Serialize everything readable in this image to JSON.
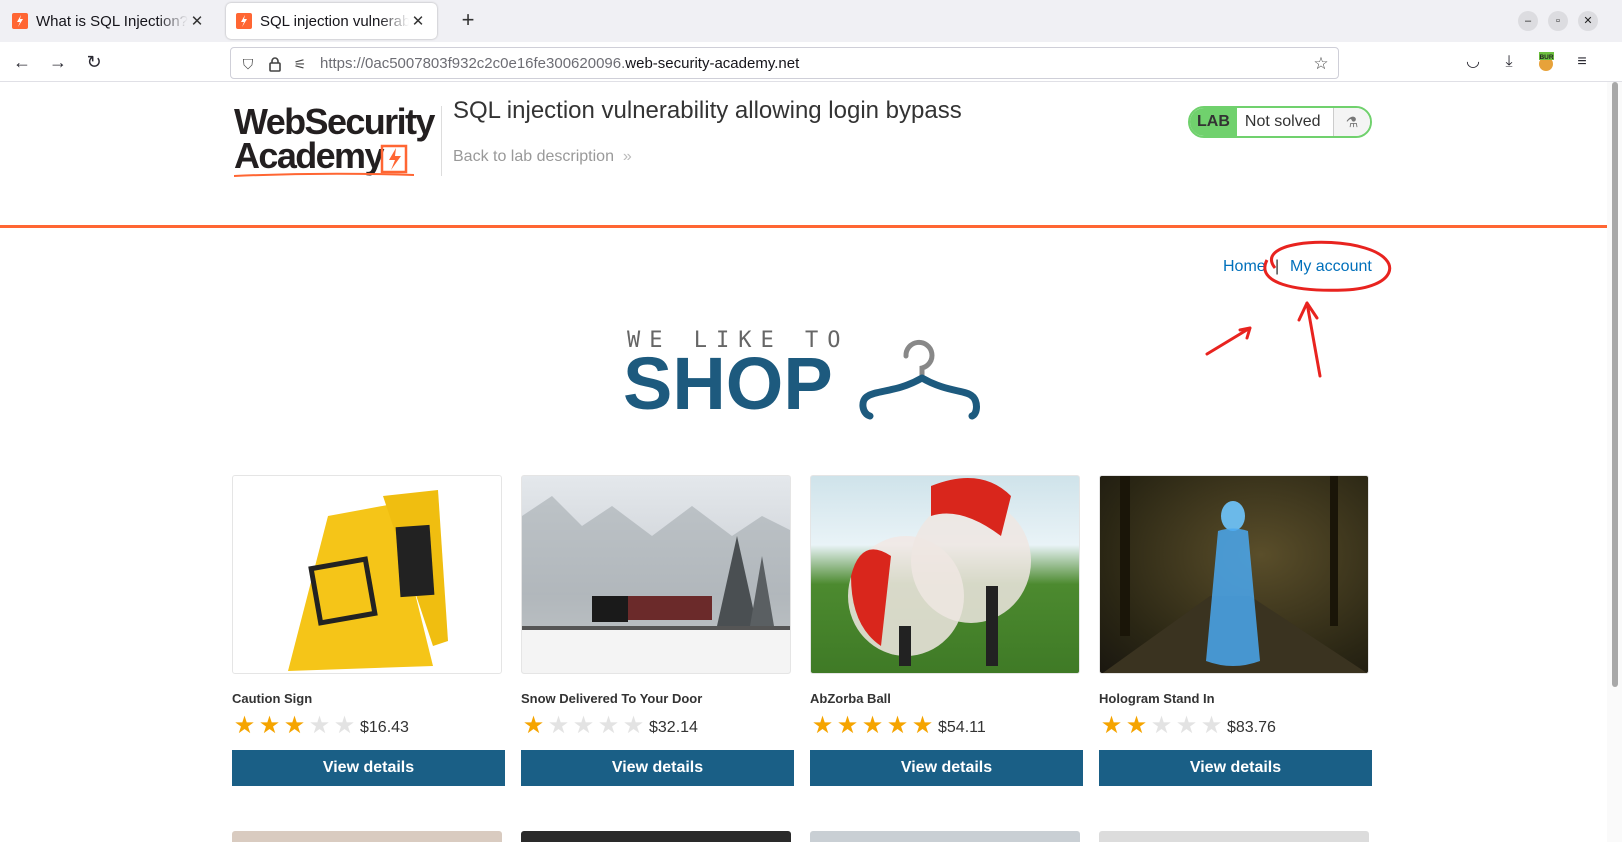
{
  "browser": {
    "tabs": [
      {
        "title": "What is SQL Injection? Tut",
        "active": false
      },
      {
        "title": "SQL injection vulnerabilit",
        "active": true
      }
    ],
    "url_prefix": "https://0ac5007803f932c2c0e16fe300620096.",
    "url_domain": "web-security-academy.net",
    "extension_label": "BUR"
  },
  "lab": {
    "logo_line1": "WebSecurity",
    "logo_line2": "Academy",
    "title": "SQL injection vulnerability allowing login bypass",
    "back_link": "Back to lab description",
    "badge_label": "LAB",
    "status": "Not solved",
    "accent_color": "#ff6633",
    "status_color": "#70d16d"
  },
  "nav": {
    "home": "Home",
    "separator": "|",
    "my_account": "My account"
  },
  "hero": {
    "line1": "WE LIKE TO",
    "line2": "SHOP"
  },
  "products": [
    {
      "name": "Caution Sign",
      "rating": 3,
      "price": "$16.43",
      "button": "View details"
    },
    {
      "name": "Snow Delivered To Your Door",
      "rating": 1,
      "price": "$32.14",
      "button": "View details"
    },
    {
      "name": "AbZorba Ball",
      "rating": 5,
      "price": "$54.11",
      "button": "View details"
    },
    {
      "name": "Hologram Stand In",
      "rating": 2,
      "price": "$83.76",
      "button": "View details"
    }
  ]
}
